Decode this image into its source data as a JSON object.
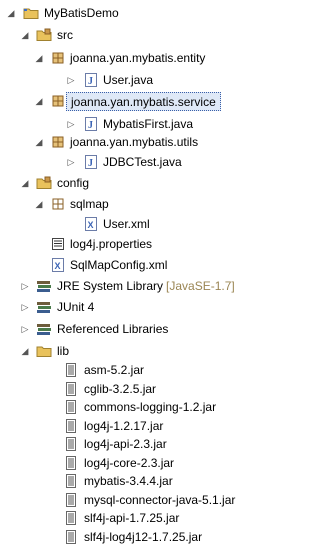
{
  "tree": {
    "project": "MyBatisDemo",
    "src": "src",
    "pkg_entity": "joanna.yan.mybatis.entity",
    "user_java": "User.java",
    "pkg_service": "joanna.yan.mybatis.service",
    "mybatisfirst_java": "MybatisFirst.java",
    "pkg_utils": "joanna.yan.mybatis.utils",
    "jdbctest_java": "JDBCTest.java",
    "config": "config",
    "sqlmap": "sqlmap",
    "user_xml": "User.xml",
    "log4j_properties": "log4j.properties",
    "sqlmapconfig_xml": "SqlMapConfig.xml",
    "jre_library": "JRE System Library",
    "jre_decoration": "[JavaSE-1.7]",
    "junit": "JUnit 4",
    "referenced_libraries": "Referenced Libraries",
    "lib": "lib",
    "jars": [
      "asm-5.2.jar",
      "cglib-3.2.5.jar",
      "commons-logging-1.2.jar",
      "log4j-1.2.17.jar",
      "log4j-api-2.3.jar",
      "log4j-core-2.3.jar",
      "mybatis-3.4.4.jar",
      "mysql-connector-java-5.1.jar",
      "slf4j-api-1.7.25.jar",
      "slf4j-log4j12-1.7.25.jar"
    ]
  },
  "colors": {
    "folder": "#e9c25c",
    "package": "#b5864a",
    "java_file": "#3a63b5",
    "selection": "#dfe9f7",
    "decoration": "#9a8553"
  }
}
